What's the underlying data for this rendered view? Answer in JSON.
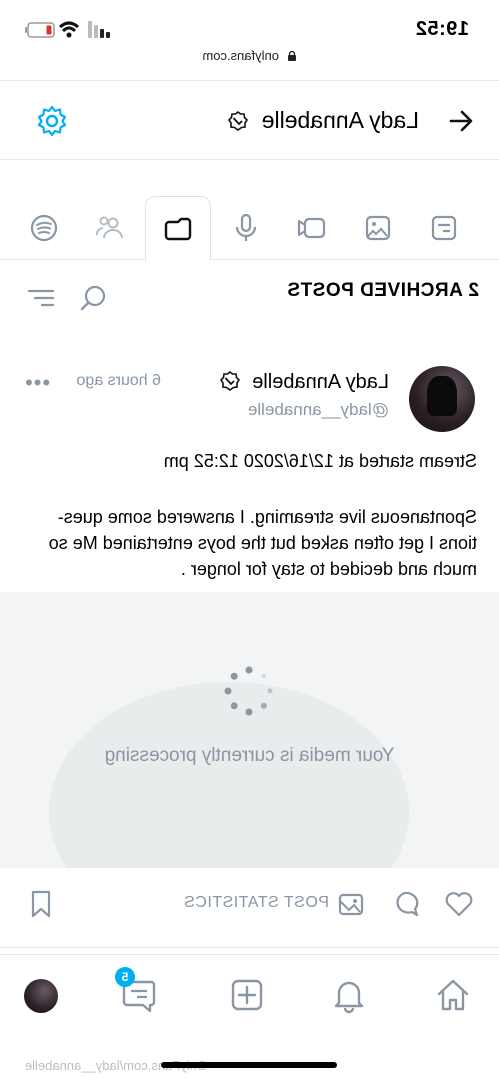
{
  "status": {
    "time": "19:52"
  },
  "browser": {
    "url": "onlyfans.com"
  },
  "header": {
    "title": "Lady Annabelle"
  },
  "tabs": [
    {
      "icon": "list-icon"
    },
    {
      "icon": "image-icon"
    },
    {
      "icon": "video-icon"
    },
    {
      "icon": "microphone-icon"
    },
    {
      "icon": "folder-icon",
      "active": true
    },
    {
      "icon": "users-icon"
    },
    {
      "icon": "spotify-icon"
    }
  ],
  "section": {
    "heading": "2 ARCHIVED POSTS"
  },
  "post": {
    "author": "Lady Annabelle",
    "handle": "@lady__annabelle",
    "time_ago": "6 hours ago",
    "text_line": "Stream started at 12/16/2020 12:52 pm",
    "text_body": "Spontaneous live streaming. I answered some ques- tions I get often asked but the boys entertained Me so much and decided to stay for longer .",
    "media_status": "Your media is currently processing",
    "stats_label": "POST STATISTICS"
  },
  "bottom_nav": {
    "messages_badge": "5"
  },
  "footer": {
    "watermark": "OnlyFans.com/lady__annabelle"
  },
  "colors": {
    "accent": "#00aff0",
    "muted": "#8a96a3",
    "divider": "#e6e8ea"
  }
}
